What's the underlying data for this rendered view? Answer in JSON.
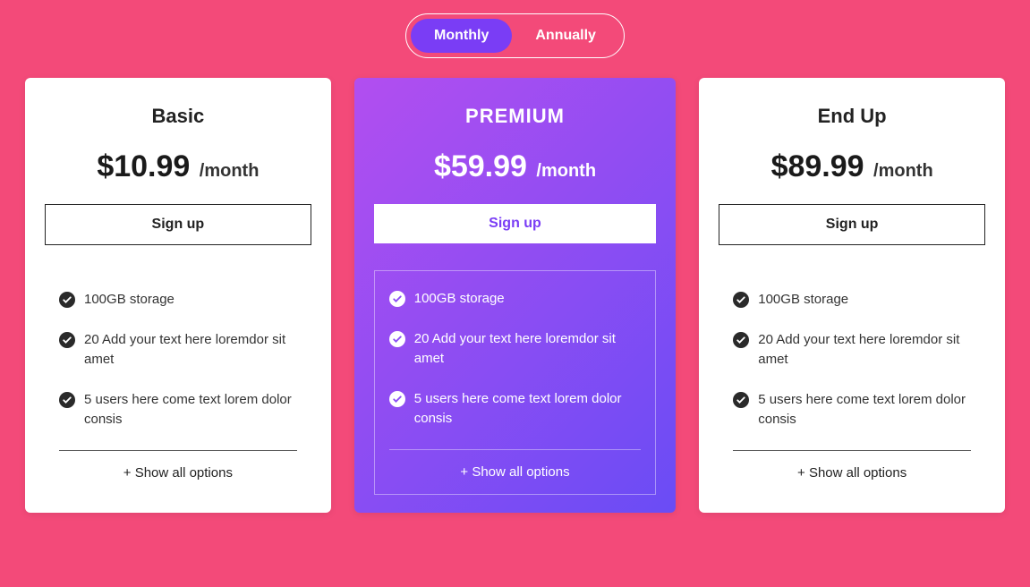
{
  "toggle": {
    "monthly": "Monthly",
    "annually": "Annually"
  },
  "plans": [
    {
      "name": "Basic",
      "price": "$10.99",
      "period": "/month",
      "signup": "Sign up",
      "features": [
        "100GB storage",
        "20 Add your text here loremdor sit amet",
        "5 users here come text lorem dolor consis"
      ],
      "show_all": "+ Show all options"
    },
    {
      "name": "PREMIUM",
      "price": "$59.99",
      "period": "/month",
      "signup": "Sign up",
      "features": [
        "100GB storage",
        "20 Add your text here loremdor sit amet",
        "5 users here come text lorem dolor consis"
      ],
      "show_all": "+ Show all options"
    },
    {
      "name": "End Up",
      "price": "$89.99",
      "period": "/month",
      "signup": "Sign up",
      "features": [
        "100GB storage",
        "20 Add your text here loremdor sit amet",
        "5 users here come text lorem dolor consis"
      ],
      "show_all": "+ Show all options"
    }
  ],
  "colors": {
    "background": "#f34a79",
    "accent": "#7a3df5",
    "gradient_start": "#b24ef0",
    "gradient_end": "#6a4cf5"
  }
}
